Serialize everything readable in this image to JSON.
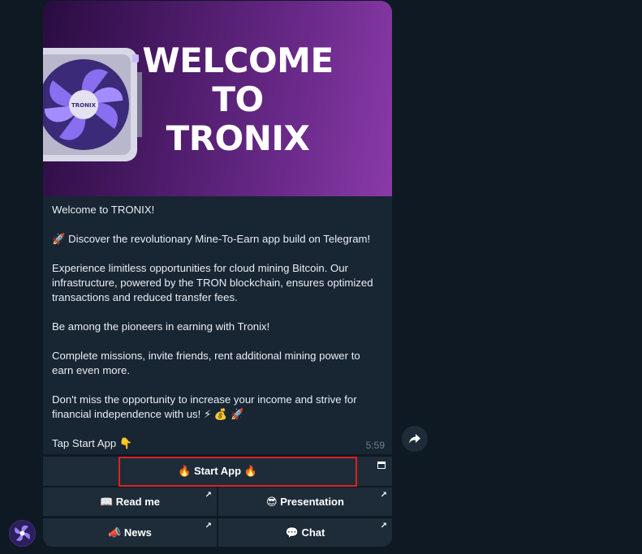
{
  "banner": {
    "title_line1": "WELCOME",
    "title_line2": "TO",
    "title_line3": "TRONIX",
    "fan_label": "TRONIX"
  },
  "message": {
    "paragraphs": [
      "Welcome to TRONIX!",
      "🚀 Discover the revolutionary Mine-To-Earn app build on Telegram!",
      "Experience limitless opportunities for cloud mining Bitcoin. Our infrastructure, powered by the TRON blockchain, ensures optimized transactions and reduced transfer fees.",
      "Be among the pioneers in earning with Tronix!",
      "Complete missions, invite friends, rent additional mining power to earn even more.",
      "Don't miss the opportunity to increase your income and strive for financial independence with us! ⚡ 💰 🚀",
      "Tap Start App 👇"
    ],
    "time": "5:59"
  },
  "keyboard": {
    "start_app": "🔥 Start App 🔥",
    "read_me": "📖 Read me",
    "presentation": "😎 Presentation",
    "news": "📣 News",
    "chat": "💬 Chat"
  },
  "colors": {
    "background": "#0f1923",
    "bubble": "#182533",
    "button": "#1e2c3a",
    "highlight": "#e02020"
  }
}
